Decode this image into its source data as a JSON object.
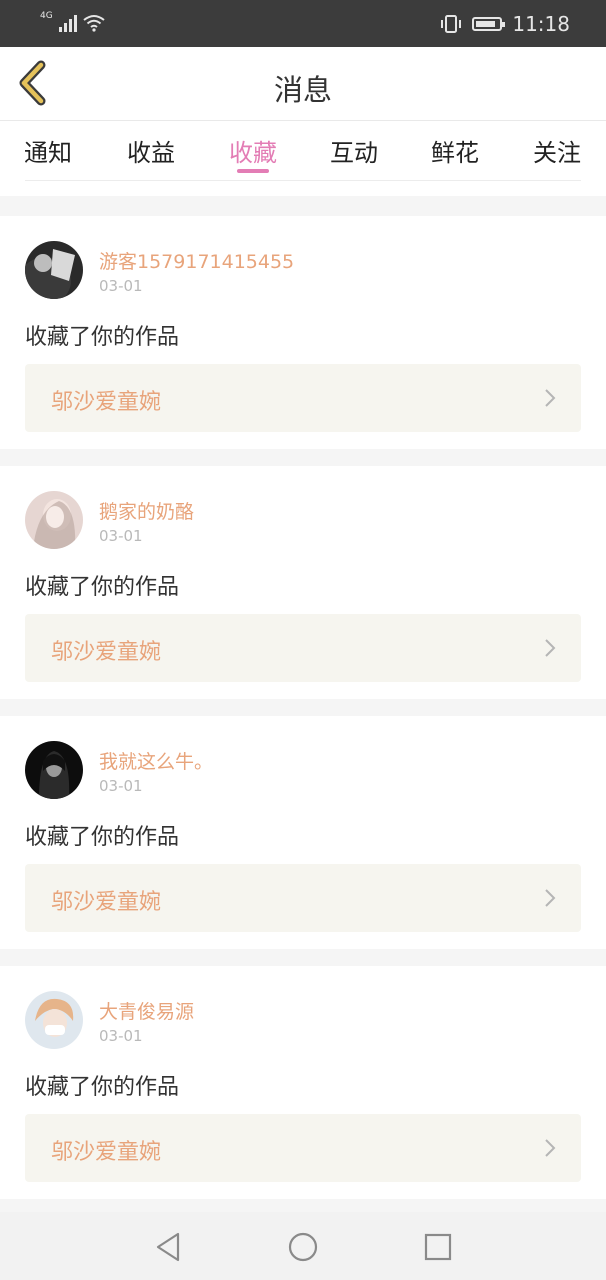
{
  "status_bar": {
    "network": "4G",
    "time": "11:18",
    "icons": [
      "signal-icon",
      "wifi-icon",
      "vibrate-icon",
      "battery-icon"
    ]
  },
  "header": {
    "title": "消息",
    "back_icon": "chevron-left-icon"
  },
  "tabs": [
    {
      "label": "通知"
    },
    {
      "label": "收益"
    },
    {
      "label": "收藏",
      "active": true
    },
    {
      "label": "互动"
    },
    {
      "label": "鲜花"
    },
    {
      "label": "关注"
    }
  ],
  "items": [
    {
      "username": "游客1579171415455",
      "date": "03-01",
      "message": "收藏了你的作品",
      "work_title": "邬沙爱童婉"
    },
    {
      "username": "鹅家的奶酪",
      "date": "03-01",
      "message": "收藏了你的作品",
      "work_title": "邬沙爱童婉"
    },
    {
      "username": "我就这么牛。",
      "date": "03-01",
      "message": "收藏了你的作品",
      "work_title": "邬沙爱童婉"
    },
    {
      "username": "大青俊易源",
      "date": "03-01",
      "message": "收藏了你的作品",
      "work_title": "邬沙爱童婉"
    }
  ],
  "colors": {
    "accent": "#e37db5",
    "username": "#e8a47b",
    "work_bg": "#f6f5ef",
    "back_icon": "#e5c25a"
  },
  "system_nav": [
    "back-triangle-icon",
    "home-circle-icon",
    "recents-square-icon"
  ]
}
